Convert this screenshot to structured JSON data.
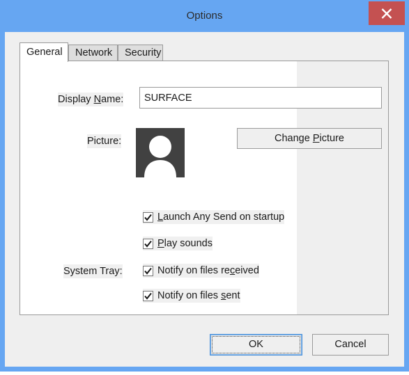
{
  "window": {
    "title": "Options",
    "titlebar_color": "#66a6f2",
    "body_color": "#efefef",
    "close_button": {
      "name": "close-button",
      "glyph": "close-x-icon",
      "color": "#c45151"
    }
  },
  "tabs": [
    {
      "label": "General",
      "selected": true
    },
    {
      "label": "Network",
      "selected": false
    },
    {
      "label": "Security",
      "selected": false
    }
  ],
  "general": {
    "display_name": {
      "label_before": "Display ",
      "label_accel": "N",
      "label_after": "ame:",
      "value": "SURFACE",
      "placeholder": ""
    },
    "picture": {
      "label": "Picture:",
      "avatar_background": "#414141",
      "avatar_foreground": "#ffffff",
      "change_button": {
        "label_before": "Change ",
        "label_accel": "P",
        "label_after": "icture"
      }
    },
    "checkboxes": [
      {
        "name": "launch-on-startup",
        "checked": true,
        "label_before": "",
        "label_accel": "L",
        "label_after": "aunch Any Send on startup"
      },
      {
        "name": "play-sounds",
        "checked": true,
        "label_before": "",
        "label_accel": "P",
        "label_after": "lay sounds"
      }
    ],
    "system_tray": {
      "label": "System Tray:",
      "checkboxes": [
        {
          "name": "notify-files-received",
          "checked": true,
          "label_before": "Notify on files re",
          "label_accel": "c",
          "label_after": "eived"
        },
        {
          "name": "notify-files-sent",
          "checked": true,
          "label_before": "Notify on files ",
          "label_accel": "s",
          "label_after": "ent"
        }
      ]
    }
  },
  "footer": {
    "ok_label": "OK",
    "cancel_label": "Cancel"
  }
}
